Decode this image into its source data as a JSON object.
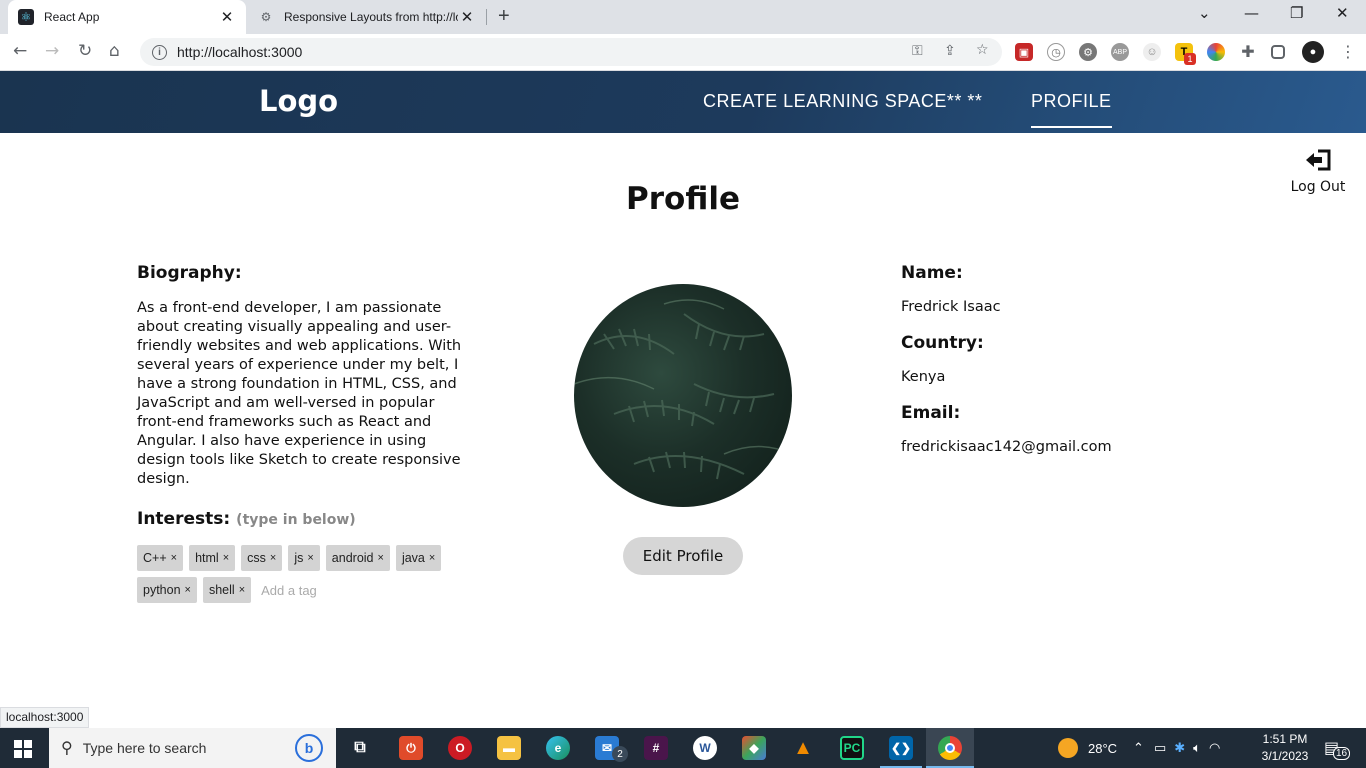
{
  "browser": {
    "tabs": [
      {
        "title": "React App",
        "icon": "react-icon"
      },
      {
        "title": "Responsive Layouts from http://lo",
        "icon": "globe-icon"
      }
    ],
    "url": "http://localhost:3000",
    "status_url": "localhost:3000",
    "extension_badge": "1"
  },
  "header": {
    "logo": "Logo",
    "nav": [
      {
        "label": "CREATE LEARNING SPACE** **",
        "active": false
      },
      {
        "label": "PROFILE",
        "active": true
      }
    ]
  },
  "page": {
    "logout_label": "Log Out",
    "title": "Profile",
    "biography_heading": "Biography:",
    "biography": "As a front-end developer, I am passionate about creating visually appealing and user-friendly websites and web applications. With several years of experience under my belt, I have a strong foundation in HTML, CSS, and JavaScript and am well-versed in popular front-end frameworks such as React and Angular. I also have experience in using design tools like Sketch to create responsive design.",
    "interests_heading": "Interests:",
    "interests_hint": "(type in below)",
    "tags": [
      "C++",
      "html",
      "css",
      "js",
      "android",
      "java",
      "python",
      "shell"
    ],
    "tag_placeholder": "Add a tag",
    "edit_button": "Edit Profile",
    "name_heading": "Name:",
    "name": "Fredrick Isaac",
    "country_heading": "Country:",
    "country": "Kenya",
    "email_heading": "Email:",
    "email": "fredrickisaac142@gmail.com"
  },
  "taskbar": {
    "search_placeholder": "Type here to search",
    "mail_badge": "2",
    "temperature": "28°C",
    "time": "1:51 PM",
    "date": "3/1/2023",
    "notification_count": "16"
  }
}
